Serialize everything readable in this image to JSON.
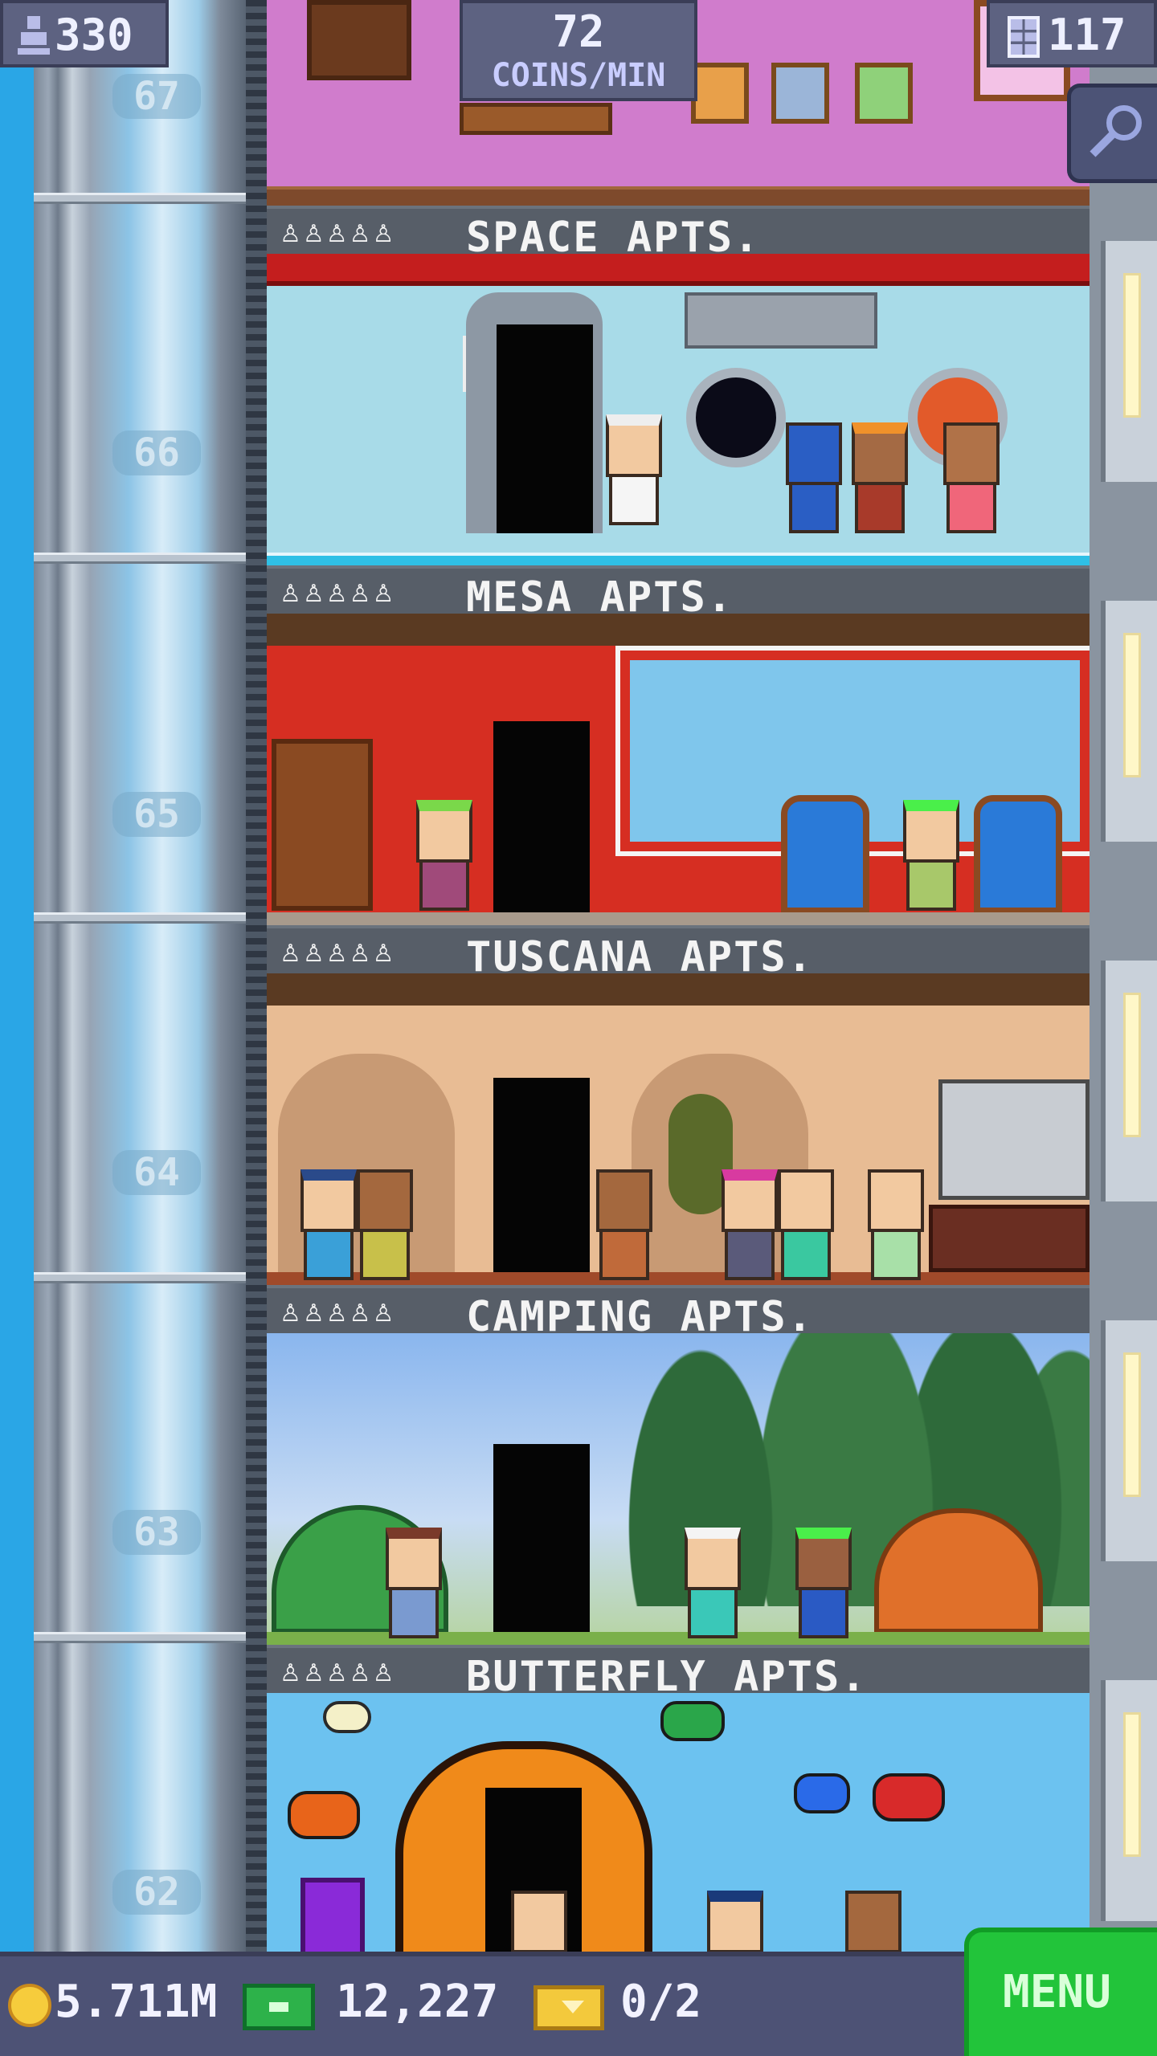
{
  "hud": {
    "population": "330",
    "coins_per_min_value": "72",
    "coins_per_min_label": "COINS/MIN",
    "floor_count": "117"
  },
  "shaft": {
    "floor_numbers": [
      "67",
      "66",
      "65",
      "64",
      "63",
      "62"
    ]
  },
  "floors": [
    {
      "name": "SPACE APTS.",
      "stars": "♙♙♙♙♙",
      "theme_color": "#a8dbe8"
    },
    {
      "name": "MESA APTS.",
      "stars": "♙♙♙♙♙",
      "theme_color": "#d62e22"
    },
    {
      "name": "TUSCANA APTS.",
      "stars": "♙♙♙♙♙",
      "theme_color": "#e8bc94"
    },
    {
      "name": "CAMPING APTS.",
      "stars": "♙♙♙♙♙",
      "theme_color": "#a6c8ee"
    },
    {
      "name": "BUTTERFLY APTS.",
      "stars": "♙♙♙♙♙",
      "theme_color": "#6cc2f0"
    }
  ],
  "bottom_bar": {
    "coins": "5.711M",
    "bux": "12,227",
    "tickets": "0/2",
    "menu_label": "MENU"
  },
  "icons": {
    "population": "person-icon",
    "floors": "building-icon",
    "search": "magnifier-icon",
    "coins": "coin-icon",
    "bux": "bux-icon",
    "tickets": "ticket-icon"
  },
  "colors": {
    "hud_panel": "#5d6281",
    "menu_button": "#22c43a",
    "floor_label_bar": "#575e68"
  }
}
